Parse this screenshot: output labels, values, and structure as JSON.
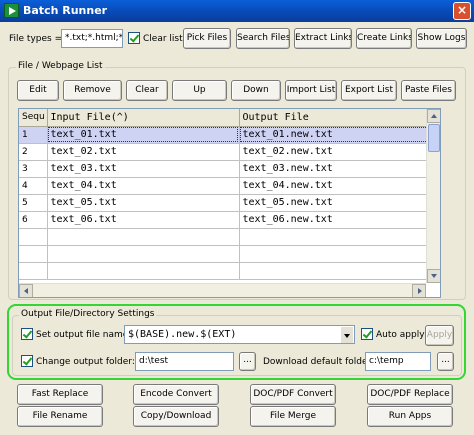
{
  "window": {
    "title": "Batch Runner",
    "close_glyph": "×"
  },
  "top_bar": {
    "file_types_label": "File types =>",
    "file_types_value": "*.txt;*.html;*.ht",
    "clear_list_label": "Clear list",
    "buttons": [
      "Pick Files",
      "Search Files",
      "Extract Links",
      "Create Links",
      "Show Logs"
    ]
  },
  "file_list": {
    "group_title": "File / Webpage List",
    "buttons": [
      "Edit",
      "Remove",
      "Clear",
      "Up",
      "Down",
      "Import List",
      "Export List",
      "Paste Files"
    ],
    "columns": [
      "Sequ",
      "Input File(^)",
      "Output File"
    ],
    "rows": [
      {
        "seq": "1",
        "input": "text_01.txt",
        "output": "text_01.new.txt"
      },
      {
        "seq": "2",
        "input": "text_02.txt",
        "output": "text_02.new.txt"
      },
      {
        "seq": "3",
        "input": "text_03.txt",
        "output": "text_03.new.txt"
      },
      {
        "seq": "4",
        "input": "text_04.txt",
        "output": "text_04.new.txt"
      },
      {
        "seq": "5",
        "input": "text_05.txt",
        "output": "text_05.new.txt"
      },
      {
        "seq": "6",
        "input": "text_06.txt",
        "output": "text_06.new.txt"
      }
    ],
    "selected_row": 0
  },
  "output_settings": {
    "group_title": "Output File/Directory Settings",
    "set_output_name_label": "Set output file name:",
    "output_name_value": "$(BASE).new.$(EXT)",
    "auto_apply_label": "Auto apply",
    "apply_label": "Apply",
    "change_folder_label": "Change output folder:",
    "output_folder_value": "d:\\test",
    "browse_label": "...",
    "download_folder_label": "Download default folder:",
    "download_folder_value": "c:\\temp"
  },
  "bottom_buttons": [
    [
      "Fast Replace",
      "Encode Convert",
      "DOC/PDF Convert",
      "DOC/PDF Replace"
    ],
    [
      "File Rename",
      "Copy/Download",
      "File Merge",
      "Run Apps"
    ]
  ],
  "colors": {
    "accent": "#33d633",
    "title_bar": "#0a5fd8",
    "selection": "#cfd3f3"
  }
}
